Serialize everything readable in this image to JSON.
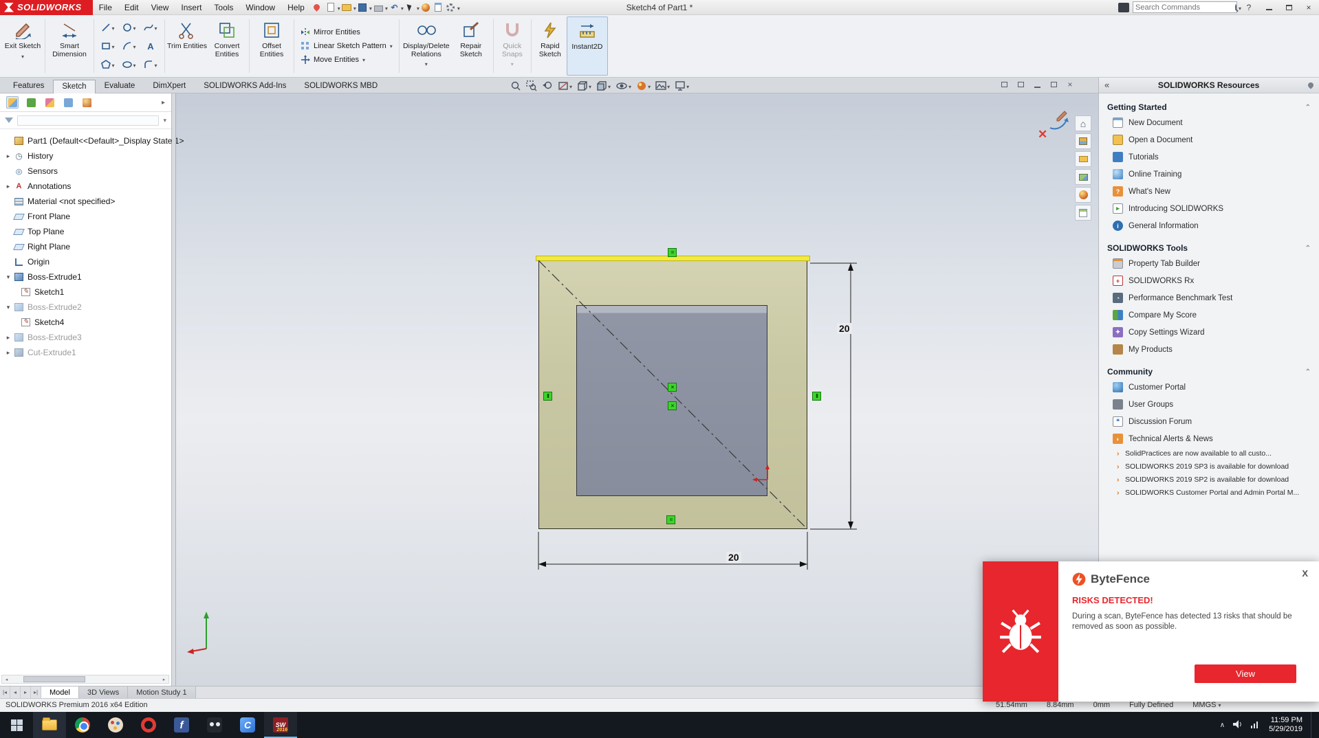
{
  "colors": {
    "accent_red": "#e8262d",
    "brand_red": "#dd1d21",
    "selection_yellow": "#f2ea3f",
    "relation_green": "#3ed32c"
  },
  "titlebar": {
    "brand": "SOLIDWORKS",
    "menus": [
      "File",
      "Edit",
      "View",
      "Insert",
      "Tools",
      "Window",
      "Help"
    ],
    "doc_title": "Sketch4 of Part1 *",
    "search_placeholder": "Search Commands",
    "help": "?"
  },
  "ribbon": {
    "tabs": [
      "Features",
      "Sketch",
      "Evaluate",
      "DimXpert",
      "SOLIDWORKS Add-Ins",
      "SOLIDWORKS MBD"
    ],
    "exit_sketch": "Exit Sketch",
    "smart_dimension": "Smart Dimension",
    "trim_entities": "Trim Entities",
    "convert_entities": "Convert Entities",
    "offset_entities": "Offset Entities",
    "mirror_entities": "Mirror Entities",
    "linear_pattern": "Linear Sketch Pattern",
    "move_entities": "Move Entities",
    "display_delete": "Display/Delete Relations",
    "repair_sketch": "Repair Sketch",
    "quick_snaps": "Quick Snaps",
    "rapid_sketch": "Rapid Sketch",
    "instant2d": "Instant2D"
  },
  "tree": {
    "items": [
      {
        "label": "Part1 (Default<<Default>_Display State 1>"
      },
      {
        "label": "History"
      },
      {
        "label": "Sensors"
      },
      {
        "label": "Annotations"
      },
      {
        "label": "Material <not specified>"
      },
      {
        "label": "Front Plane"
      },
      {
        "label": "Top Plane"
      },
      {
        "label": "Right Plane"
      },
      {
        "label": "Origin"
      },
      {
        "label": "Boss-Extrude1"
      },
      {
        "label": "Sketch1"
      },
      {
        "label": "Boss-Extrude2"
      },
      {
        "label": "Sketch4"
      },
      {
        "label": "Boss-Extrude3"
      },
      {
        "label": "Cut-Extrude1"
      }
    ]
  },
  "sketch": {
    "dim_vertical": "20",
    "dim_horizontal": "20"
  },
  "taskpane": {
    "header": "SOLIDWORKS Resources",
    "getting_started": {
      "title": "Getting Started",
      "items": [
        "New Document",
        "Open a Document",
        "Tutorials",
        "Online Training",
        "What's New",
        "Introducing SOLIDWORKS",
        "General Information"
      ]
    },
    "tools": {
      "title": "SOLIDWORKS Tools",
      "items": [
        "Property Tab Builder",
        "SOLIDWORKS Rx",
        "Performance Benchmark Test",
        "Compare My Score",
        "Copy Settings Wizard",
        "My Products"
      ]
    },
    "community": {
      "title": "Community",
      "items": [
        "Customer Portal",
        "User Groups",
        "Discussion Forum",
        "Technical Alerts & News"
      ]
    },
    "news": [
      "SolidPractices are now available to all custo...",
      "SOLIDWORKS 2019 SP3 is available for download",
      "SOLIDWORKS 2019 SP2 is available for download",
      "SOLIDWORKS Customer Portal and Admin Portal M..."
    ]
  },
  "doctabs": {
    "model": "Model",
    "views": "3D Views",
    "motion": "Motion Study 1"
  },
  "status": {
    "left": "SOLIDWORKS Premium 2016 x64 Edition",
    "x": "51.54mm",
    "y": "8.84mm",
    "z": "0mm",
    "state": "Fully Defined",
    "units": "MMGS"
  },
  "bytefence": {
    "brand": "ByteFence",
    "title": "RISKS DETECTED!",
    "body": "During a scan, ByteFence has detected 13 risks that should be removed as soon as possible.",
    "button": "View",
    "close": "X"
  },
  "taskbar": {
    "sw_badge": "2016",
    "clock_time": "11:59 PM",
    "clock_date": "5/29/2019"
  }
}
